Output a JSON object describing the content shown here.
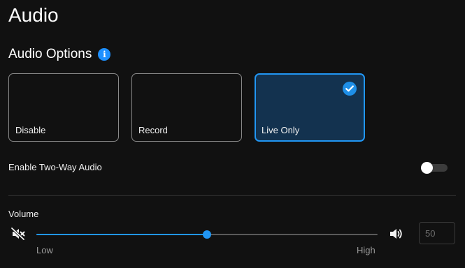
{
  "page": {
    "title": "Audio"
  },
  "audio_options": {
    "title": "Audio Options",
    "info_icon": "info-icon",
    "options": [
      {
        "label": "Disable",
        "selected": false
      },
      {
        "label": "Record",
        "selected": false
      },
      {
        "label": "Live Only",
        "selected": true
      }
    ],
    "selected_icon": "check-circle-icon"
  },
  "two_way_audio": {
    "label": "Enable Two-Way Audio",
    "enabled": false
  },
  "volume": {
    "label": "Volume",
    "value": "50",
    "fraction": 0.5,
    "low_label": "Low",
    "high_label": "High",
    "mute_icon": "volume-mute-icon",
    "max_icon": "volume-up-icon"
  },
  "colors": {
    "accent": "#2196f3",
    "selected_card_bg": "#13324f",
    "background": "#111111"
  }
}
